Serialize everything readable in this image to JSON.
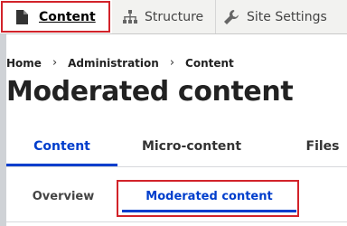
{
  "toolbar": {
    "items": [
      {
        "label": "Content",
        "icon": "page-icon",
        "active": true
      },
      {
        "label": "Structure",
        "icon": "sitemap-icon"
      },
      {
        "label": "Site Settings",
        "icon": "wrench-icon"
      }
    ]
  },
  "breadcrumb": [
    "Home",
    "Administration",
    "Content"
  ],
  "breadcrumb_separator": "›",
  "page": {
    "title": "Moderated content"
  },
  "primary_tabs": [
    {
      "label": "Content",
      "active": true
    },
    {
      "label": "Micro-content"
    },
    {
      "label": "Files"
    }
  ],
  "secondary_tabs": [
    {
      "label": "Overview"
    },
    {
      "label": "Moderated content",
      "active": true
    }
  ],
  "colors": {
    "accent": "#003ecc",
    "highlight_box": "#d2232a",
    "toolbar_bg": "#f2f2f0",
    "rail": "#cfd2d6"
  }
}
